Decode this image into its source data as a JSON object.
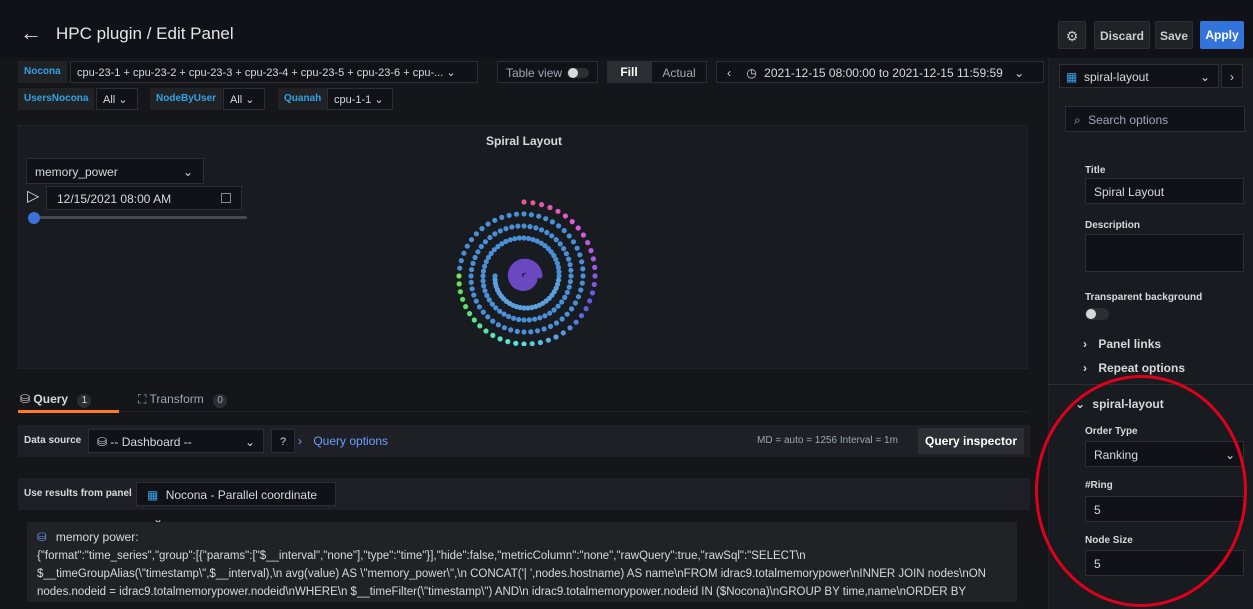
{
  "header": {
    "back_icon": "back-arrow-icon",
    "title": "HPC plugin / Edit Panel",
    "discard": "Discard",
    "save": "Save",
    "apply": "Apply",
    "settings_icon": "gear-icon"
  },
  "variables": {
    "nocona_label": "Nocona",
    "nocona_value": "cpu-23-1 + cpu-23-2 + cpu-23-3 + cpu-23-4 + cpu-23-5 + cpu-23-6 + cpu-... ⌄",
    "users_label": "UsersNocona",
    "users_value": "All ⌄",
    "nodebyuser_label": "NodeByUser",
    "nodebyuser_value": "All ⌄",
    "quanah_label": "Quanah",
    "quanah_value": "cpu-1-1 ⌄"
  },
  "toolbar": {
    "table_view": "Table view",
    "fill": "Fill",
    "actual": "Actual",
    "time_range": "2021-12-15 08:00:00 to 2021-12-15 11:59:59",
    "prev": "‹",
    "next": "›"
  },
  "panel": {
    "title": "Spiral Layout",
    "metric": "memory_power",
    "datetime": "12/15/2021 08:00 AM",
    "slider_value": 0
  },
  "query_tabs": {
    "query_label": "Query",
    "query_count": "1",
    "transform_label": "Transform",
    "transform_count": "0"
  },
  "query_bar": {
    "data_source_label": "Data source",
    "data_source_value": "-- Dashboard --",
    "query_options": "Query options",
    "md_info": "MD = auto = 1256   Interval = 1m",
    "query_inspector": "Query inspector"
  },
  "use_results": {
    "label": "Use results from panel",
    "value": "Nocona - Parallel coordinate"
  },
  "query_text": {
    "name": "memory power:",
    "body": "{\"format\":\"time_series\",\"group\":[{\"params\":[\"$__interval\",\"none\"],\"type\":\"time\"}],\"hide\":false,\"metricColumn\":\"none\",\"rawQuery\":true,\"rawSql\":\"SELECT\\n $__timeGroupAlias(\\\"timestamp\\\",$__interval),\\n avg(value) AS \\\"memory_power\\\",\\n CONCAT('| ',nodes.hostname) AS name\\nFROM idrac9.totalmemorypower\\nINNER JOIN nodes\\nON nodes.nodeid = idrac9.totalmemorypower.nodeid\\nWHERE\\n $__timeFilter(\\\"timestamp\\\") AND\\n idrac9.totalmemorypower.nodeid IN ($Nocona)\\nGROUP BY time,name\\nORDER BY"
  },
  "options": {
    "viz": "spiral-layout",
    "search_placeholder": "Search options",
    "title_label": "Title",
    "title_value": "Spiral Layout",
    "description_label": "Description",
    "transparent_label": "Transparent background",
    "panel_links": "Panel links",
    "repeat_options": "Repeat options",
    "section": "spiral-layout",
    "order_type_label": "Order Type",
    "order_type_value": "Ranking",
    "ring_label": "#Ring",
    "ring_value": "5",
    "node_size_label": "Node Size",
    "node_size_value": "5"
  }
}
